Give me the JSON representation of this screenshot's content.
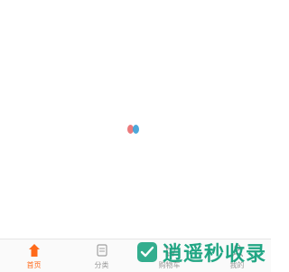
{
  "colors": {
    "accent": "#ff6a1a",
    "spinner_red": "#e96b6e",
    "spinner_blue": "#3a9fd6",
    "watermark": "#0f9f7a"
  },
  "loading": {
    "icon": "loading-dots-icon"
  },
  "tabbar": {
    "tabs": [
      {
        "label": "首页",
        "icon": "home-icon",
        "active": true
      },
      {
        "label": "分类",
        "icon": "category-icon",
        "active": false
      },
      {
        "label": "购物车",
        "icon": "cart-icon",
        "active": false
      },
      {
        "label": "我的",
        "icon": "user-icon",
        "active": false
      }
    ]
  },
  "watermark": {
    "text": "逍遥秒收录"
  }
}
